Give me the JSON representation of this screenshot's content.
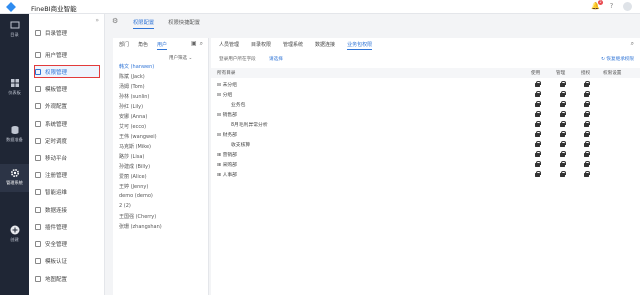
{
  "app": {
    "title": "FineBI商业智能",
    "notification_count": "2"
  },
  "left_nav": [
    {
      "label": "目录",
      "icon": "folder-icon"
    },
    {
      "label": "仪表板",
      "icon": "dashboard-icon"
    },
    {
      "label": "数据准备",
      "icon": "database-icon"
    },
    {
      "label": "管理系统",
      "icon": "gear-icon",
      "active": true
    },
    {
      "label": "创建",
      "icon": "plus-icon"
    }
  ],
  "side_menu": [
    "目录管理",
    "用户管理",
    "权限管理",
    "模板管理",
    "外观配置",
    "系统管理",
    "定时调度",
    "移动平台",
    "注册管理",
    "智能运维",
    "数据连接",
    "插件管理",
    "安全管理",
    "模板认证",
    "地图配置"
  ],
  "side_menu_selected": 2,
  "main_tabs": [
    "权限配置",
    "权限快捷配置"
  ],
  "left_panel": {
    "tabs": [
      "部门",
      "角色",
      "用户"
    ],
    "active_tab": 2,
    "filter_label": "用户筛选",
    "users": [
      "韩文 (hanwen)",
      "陈斌 (Jack)",
      "汤姆 (Tom)",
      "孙林 (sunlin)",
      "孙红 (Lily)",
      "安娜 (Anna)",
      "艾可 (ecco)",
      "王伟 (wangwei)",
      "马克斯 (Mike)",
      "路莎 (Lisa)",
      "孙建成 (Billy)",
      "爱丽 (Alice)",
      "王婷 (Jenny)",
      "demo (demo)",
      "2 (2)",
      "王国强 (Cherry)",
      "张珊 (zhangshan)"
    ]
  },
  "right_panel": {
    "tabs": [
      "人员管理",
      "目录权限",
      "管理系统",
      "数据连接",
      "业务包权限"
    ],
    "active_tab": 4,
    "info": "登录用户所在字段",
    "info_link": "请选择",
    "restore": "恢复继承权限",
    "columns": [
      "所有目录",
      "使用",
      "管理",
      "授权",
      "权限设置"
    ],
    "tree": [
      {
        "label": "未分组",
        "prefix": "⊟",
        "indent": 0
      },
      {
        "label": "分组",
        "prefix": "⊟",
        "indent": 0
      },
      {
        "label": "业务包",
        "prefix": "",
        "indent": 2
      },
      {
        "label": "销售部",
        "prefix": "⊟",
        "indent": 0
      },
      {
        "label": "8月毛利异常分析",
        "prefix": "",
        "indent": 2
      },
      {
        "label": "财务部",
        "prefix": "⊟",
        "indent": 0
      },
      {
        "label": "收支核算",
        "prefix": "",
        "indent": 2
      },
      {
        "label": "营销部",
        "prefix": "⊞",
        "indent": 0
      },
      {
        "label": "采购部",
        "prefix": "⊞",
        "indent": 0
      },
      {
        "label": "人事部",
        "prefix": "⊞",
        "indent": 0
      }
    ]
  }
}
